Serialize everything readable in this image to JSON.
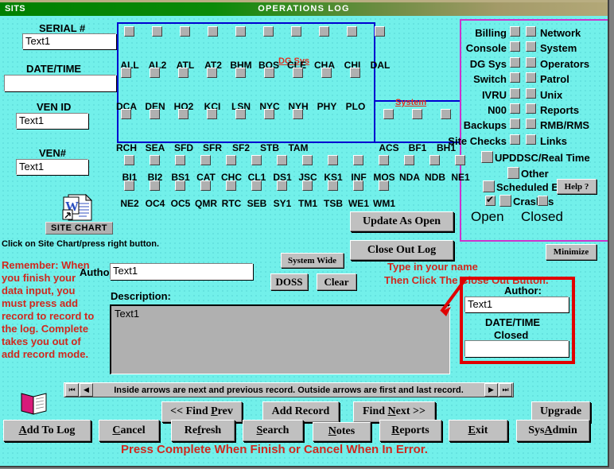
{
  "window": {
    "app_name": "SITS",
    "title": "OPERATIONS LOG"
  },
  "left_panel": {
    "serial_label": "SERIAL #",
    "serial_value": "Text1",
    "datetime_label": "DATE/TIME",
    "datetime_value": "",
    "venid_label": "VEN ID",
    "venid_value": "Text1",
    "vennum_label": "VEN#",
    "vennum_value": "Text1",
    "site_chart_button": "SITE CHART",
    "site_chart_icon": "word-document-shortcut-icon",
    "site_chart_hint": "Click on Site Chart/press right button.",
    "reminder_lines": [
      "Remember: When",
      "you finish your",
      "data input, you",
      "must press add",
      "record to record to",
      "the log.  Complete",
      "takes you out of",
      "add record mode."
    ]
  },
  "site_grid": {
    "group_label_dg_sys": "DG Sys",
    "group_label_system": "System",
    "row1": [
      "ALL",
      "AL2",
      "ATL",
      "AT2",
      "BHM",
      "BOS",
      "CLE",
      "CHA",
      "CHI",
      "DAL"
    ],
    "row2": [
      "DCA",
      "DEN",
      "HQ2",
      "KCI",
      "LSN",
      "NYC",
      "NYH",
      "PHY",
      "PLO"
    ],
    "row3": [
      "RCH",
      "SEA",
      "SFD",
      "SFR",
      "SF2",
      "STB",
      "TAM"
    ],
    "row3b": [
      "ACS",
      "BF1",
      "BH1"
    ],
    "row4": [
      "BI1",
      "BI2",
      "BS1",
      "CAT",
      "CHC",
      "CL1",
      "DS1",
      "JSC",
      "KS1",
      "INF",
      "MOS",
      "NDA",
      "NDB",
      "NE1"
    ],
    "row5": [
      "NE2",
      "OC4",
      "OC5",
      "QMR",
      "RTC",
      "SEB",
      "SY1",
      "TM1",
      "TSB",
      "WE1",
      "WM1"
    ]
  },
  "category_panel": {
    "left_column": [
      "Billing",
      "Console",
      "DG Sys",
      "Switch",
      "IVRU",
      "N00",
      "Backups",
      "Site Checks"
    ],
    "right_column": [
      "Network",
      "System",
      "Operators",
      "Patrol",
      "Unix",
      "Reports",
      "RMB/RMS",
      "Links"
    ],
    "wide_items": [
      "UPDDSC/Real Time",
      "Other",
      "Scheduled Event",
      "Crashes"
    ],
    "help_button": "Help ?",
    "status_open": "Open",
    "status_closed": "Closed",
    "open_checked": true,
    "closed_checked": false
  },
  "form": {
    "author_label": "Author:",
    "author_value": "Text1",
    "description_label": "Description:",
    "description_value": "Text1"
  },
  "actions": {
    "update_as_open": "Update As Open",
    "close_out_log": "Close Out Log",
    "system_wide": "System Wide",
    "doss": "DOSS",
    "clear": "Clear",
    "minimize": "Minimize"
  },
  "closeout_box": {
    "author_label": "Author:",
    "author_value": "Text1",
    "datetime_label_1": "DATE/TIME",
    "datetime_label_2": "Closed",
    "datetime_value": ""
  },
  "annotations": {
    "type_name_line1": "Type in your name",
    "type_name_line2": "Then Click The Close Out Button.",
    "footer_warning": "Press Complete When Finish or Cancel When In Error."
  },
  "navigation": {
    "first_icon": "first-record-icon",
    "prev_icon": "previous-record-icon",
    "next_icon": "next-record-icon",
    "last_icon": "last-record-icon",
    "hint": "Inside arrows are next and previous record.  Outside arrows are first and last record.",
    "book_icon": "open-book-icon"
  },
  "record_buttons": {
    "find_prev": "<< Find Prev",
    "find_prev_accel": "P",
    "add_record": "Add Record",
    "find_next": "Find Next >>",
    "find_next_accel": "N",
    "upgrade": "Upgrade"
  },
  "bottom_buttons": [
    {
      "label": "Add To Log",
      "accel": "A"
    },
    {
      "label": "Cancel",
      "accel": "C"
    },
    {
      "label": "Refresh",
      "accel": "f"
    },
    {
      "label": "Search",
      "accel": "S"
    },
    {
      "label": "Notes",
      "accel": "N"
    },
    {
      "label": "Reports",
      "accel": "R"
    },
    {
      "label": "Exit",
      "accel": "E"
    },
    {
      "label": "SysAdmin",
      "accel": "A"
    }
  ],
  "colors": {
    "canvas": "#72f0ea",
    "title_start": "#008000",
    "title_end": "#b3a878",
    "accent_red": "#d0281e",
    "box_blue": "#0000d0",
    "box_magenta": "#cc33cc",
    "box_red": "#e00000",
    "button_face": "#c0c0c0"
  }
}
